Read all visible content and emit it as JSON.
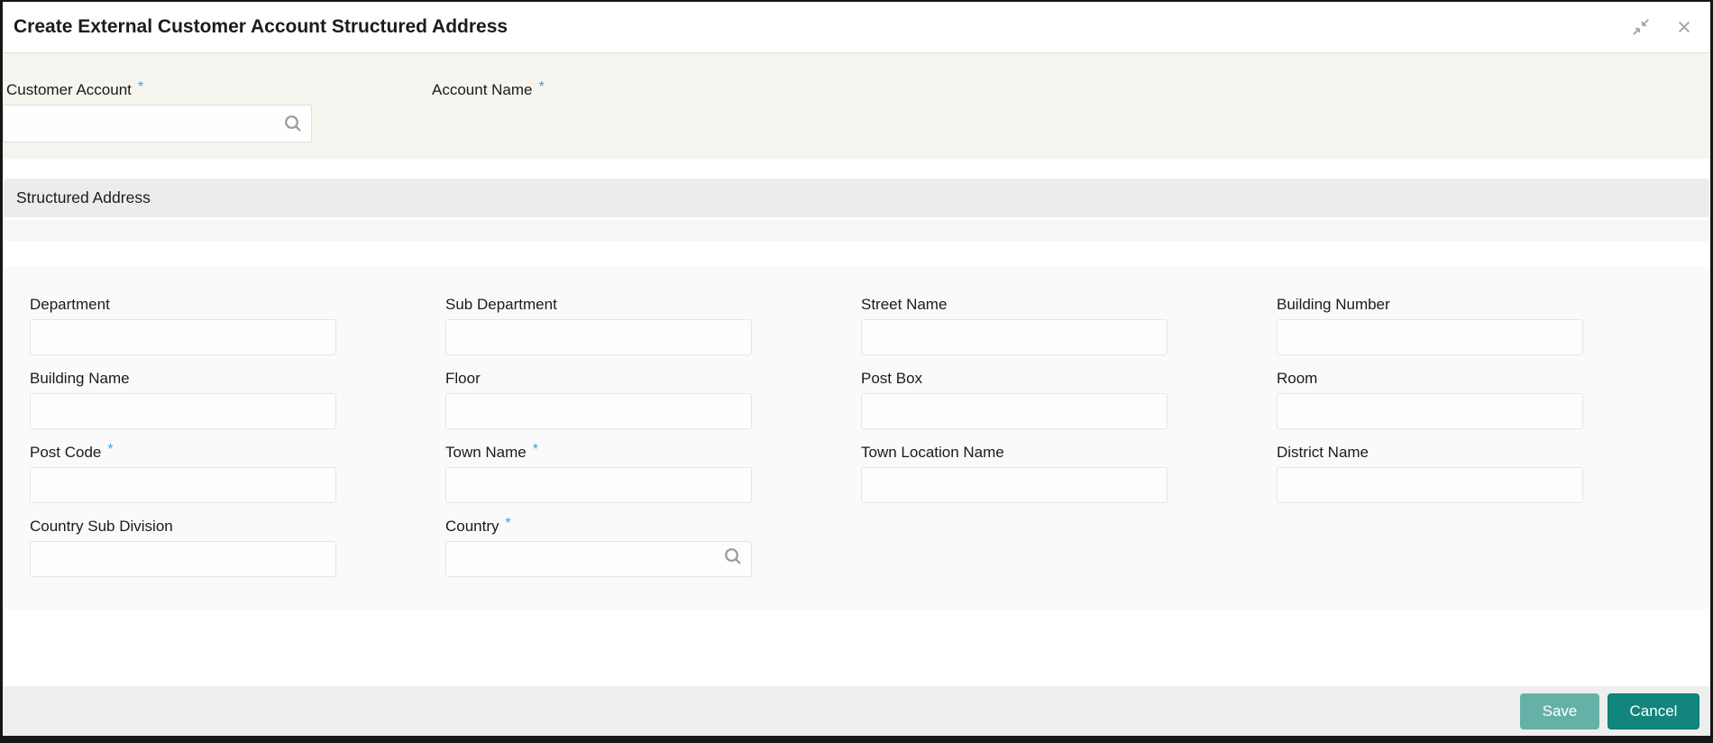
{
  "titlebar": {
    "title": "Create External Customer Account Structured Address"
  },
  "context_section": {
    "customer_account": {
      "label": "Customer Account",
      "required_mark": "*",
      "value": ""
    },
    "account_name": {
      "label": "Account Name",
      "required_mark": "*",
      "value": ""
    }
  },
  "structured_address": {
    "header": "Structured Address",
    "fields": [
      {
        "label": "Department",
        "value": ""
      },
      {
        "label": "Sub Department",
        "value": ""
      },
      {
        "label": "Street Name",
        "value": ""
      },
      {
        "label": "Building Number",
        "value": ""
      },
      {
        "label": "Building Name",
        "value": ""
      },
      {
        "label": "Floor",
        "value": ""
      },
      {
        "label": "Post Box",
        "value": ""
      },
      {
        "label": "Room",
        "value": ""
      },
      {
        "label": "Post Code",
        "required_mark": "*",
        "value": ""
      },
      {
        "label": "Town Name",
        "required_mark": "*",
        "value": ""
      },
      {
        "label": "Town Location Name",
        "value": ""
      },
      {
        "label": "District Name",
        "value": ""
      },
      {
        "label": "Country Sub Division",
        "value": ""
      },
      {
        "label": "Country",
        "required_mark": "*",
        "value": ""
      }
    ]
  },
  "footer": {
    "save_label": "Save",
    "cancel_label": "Cancel"
  },
  "colors": {
    "required_asterisk": "#35a4dc",
    "save_button": "#65b1a8",
    "cancel_button": "#12857c",
    "context_background": "#f5f4ef",
    "section_band_background": "#ececec",
    "icon_gray": "#a9a59c"
  }
}
